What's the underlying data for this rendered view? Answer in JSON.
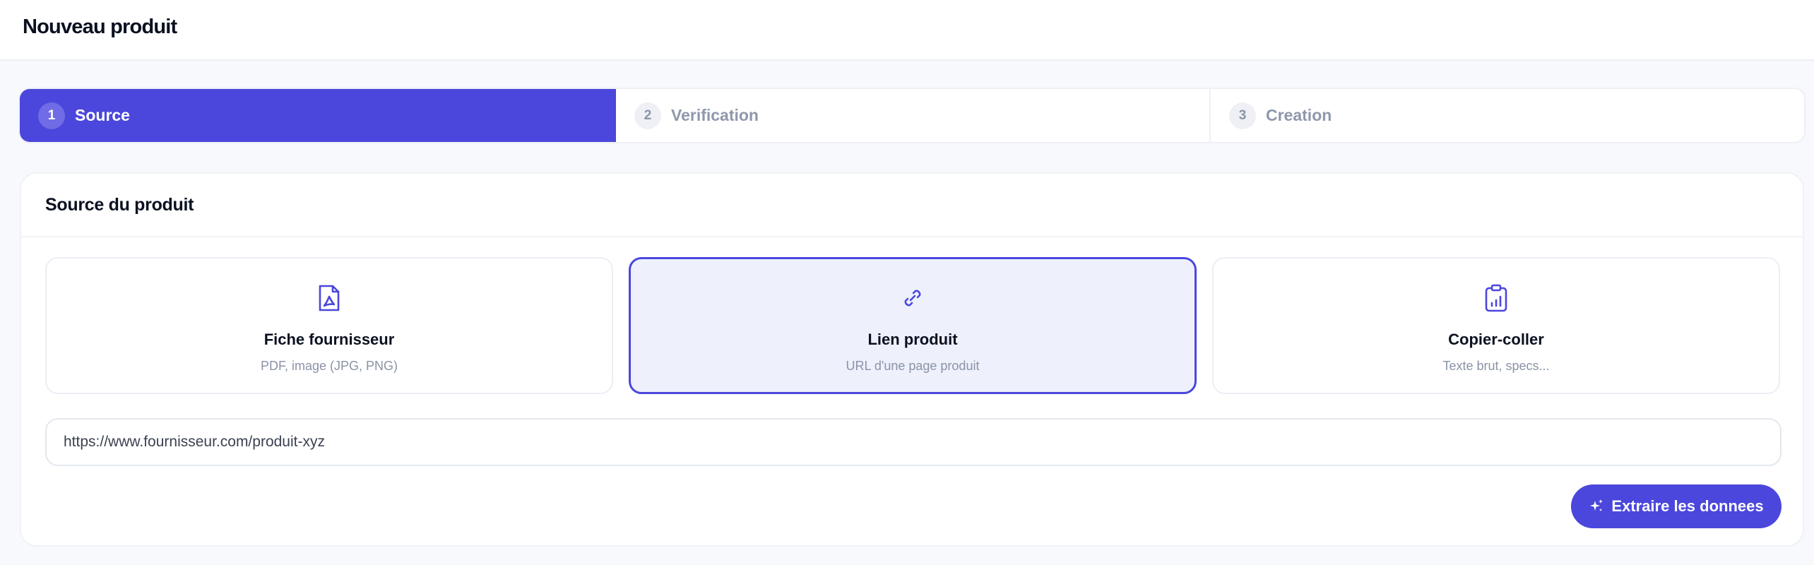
{
  "header": {
    "title": "Nouveau produit"
  },
  "stepper": {
    "steps": [
      {
        "number": "1",
        "label": "Source"
      },
      {
        "number": "2",
        "label": "Verification"
      },
      {
        "number": "3",
        "label": "Creation"
      }
    ],
    "active_step": 1
  },
  "source": {
    "title": "Source du produit",
    "options": [
      {
        "title": "Fiche fournisseur",
        "subtitle": "PDF, image (JPG, PNG)",
        "icon": "file-pdf-icon"
      },
      {
        "title": "Lien produit",
        "subtitle": "URL d'une page produit",
        "icon": "link-icon"
      },
      {
        "title": "Copier-coller",
        "subtitle": "Texte brut, specs...",
        "icon": "clipboard-icon"
      }
    ],
    "selected_option": 2,
    "url_value": "https://www.fournisseur.com/produit-xyz",
    "extract_label": "Extraire les donnees"
  },
  "colors": {
    "accent": "#4b47dc",
    "selected_bg": "#eef0fc",
    "muted_text": "#8e98ac"
  }
}
